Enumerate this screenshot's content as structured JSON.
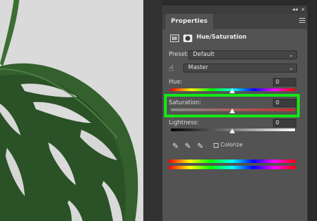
{
  "panel": {
    "tab_label": "Properties",
    "collapse_glyph": "◂◂",
    "close_glyph": "×",
    "title": "Hue/Saturation"
  },
  "controls": {
    "preset_label": "Preset:",
    "preset_value": "Default",
    "range_value": "Master",
    "hue_label": "Hue:",
    "hue_value": "0",
    "saturation_label": "Saturation:",
    "saturation_value": "0",
    "lightness_label": "Lightness:",
    "lightness_value": "0",
    "colorize_label": "Colorize"
  },
  "icons": [
    "adjustment-icon",
    "mask-icon",
    "hand-icon",
    "eyedropper-icon",
    "eyedropper-plus-icon",
    "eyedropper-minus-icon",
    "panel-menu-icon",
    "chevron-down-icon"
  ],
  "colors": {
    "highlight": "#14e614",
    "panel_bg": "#535353",
    "leaf": "#2f5a2a"
  }
}
